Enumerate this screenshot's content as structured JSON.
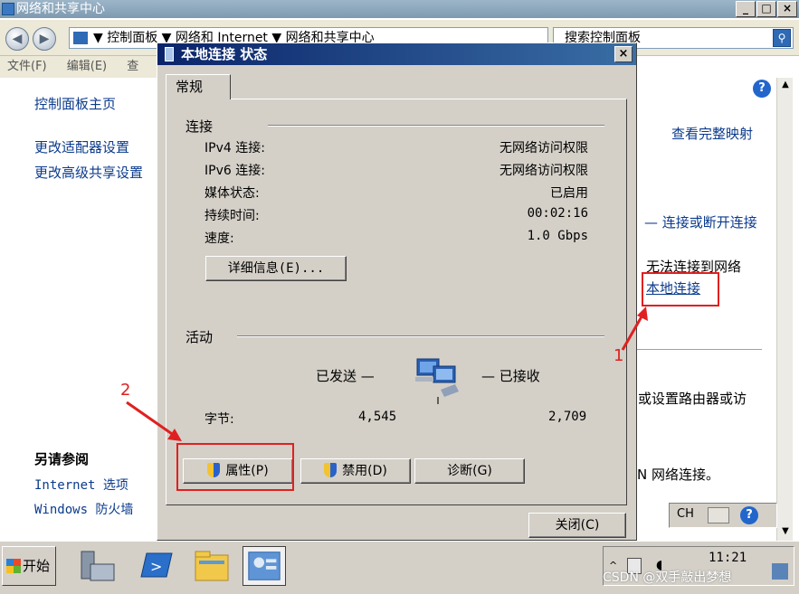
{
  "window": {
    "title": "网络和共享中心",
    "breadcrumb": "▼ 控制面板 ▼ 网络和 Internet ▼ 网络和共享中心",
    "search_placeholder": "搜索控制面板",
    "menu": [
      "文件(F)",
      "编辑(E)",
      "查"
    ],
    "min_label": "_",
    "max_label": "□",
    "close_label": "×"
  },
  "sidebar": {
    "home": "控制面板主页",
    "adapter": "更改适配器设置",
    "sharing": "更改高级共享设置",
    "see_also_title": "另请参阅",
    "see_also_items": [
      "Internet 选项",
      "Windows 防火墙"
    ]
  },
  "right": {
    "view_map": "查看完整映射",
    "connect": "— 连接或断开连接",
    "no_network": "无法连接到网络",
    "local_conn": "本地连接",
    "router_text": "或设置路由器或访",
    "n_conn": "N 网络连接。"
  },
  "dialog": {
    "title": "本地连接 状态",
    "close": "×",
    "tab": "常规",
    "connection_group": "连接",
    "rows": [
      {
        "label": "IPv4 连接:",
        "value": "无网络访问权限"
      },
      {
        "label": "IPv6 连接:",
        "value": "无网络访问权限"
      },
      {
        "label": "媒体状态:",
        "value": "已启用"
      },
      {
        "label": "持续时间:",
        "value": "00:02:16"
      },
      {
        "label": "速度:",
        "value": "1.0 Gbps"
      }
    ],
    "details_btn": "详细信息(E)...",
    "activity_group": "活动",
    "sent_label": "已发送 —",
    "recv_label": "— 已接收",
    "bytes_label": "字节:",
    "bytes_sent": "4,545",
    "bytes_recv": "2,709",
    "properties_btn": "属性(P)",
    "disable_btn": "禁用(D)",
    "diagnose_btn": "诊断(G)",
    "close_btn": "关闭(C)"
  },
  "annotations": {
    "one": "1",
    "two": "2"
  },
  "taskbar": {
    "start": "开始",
    "time": "11:21",
    "lang": "CH",
    "watermark": "CSDN @双手敲出梦想"
  },
  "colors": {
    "accent": "#0a246a",
    "link": "#0b3b8c",
    "annotation": "#e02020",
    "face": "#d4d0c8"
  }
}
